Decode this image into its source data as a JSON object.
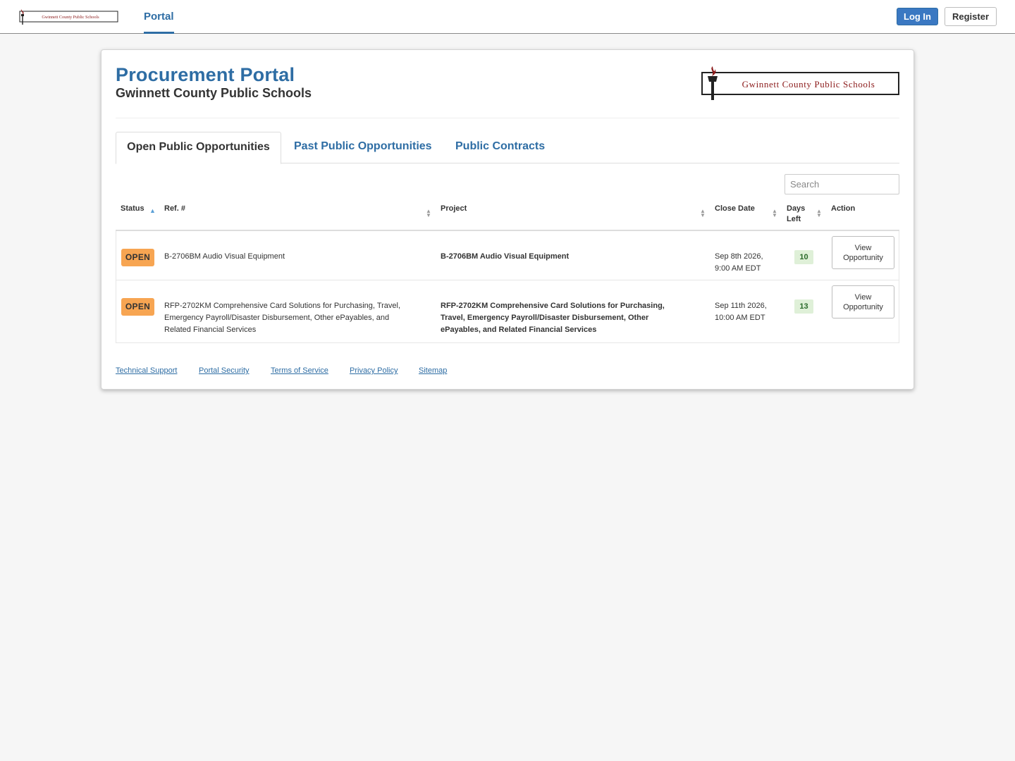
{
  "nav": {
    "logo_text": "Gwinnett County Public Schools",
    "portal_label": "Portal",
    "login_label": "Log In",
    "register_label": "Register"
  },
  "header": {
    "title": "Procurement Portal",
    "subtitle": "Gwinnett County Public Schools",
    "logo_text": "Gwinnett County Public Schools"
  },
  "tabs": [
    {
      "label": "Open Public Opportunities",
      "active": true
    },
    {
      "label": "Past Public Opportunities",
      "active": false
    },
    {
      "label": "Public Contracts",
      "active": false
    }
  ],
  "search": {
    "placeholder": "Search"
  },
  "table": {
    "columns": [
      "Status",
      "Ref. #",
      "Project",
      "Close Date",
      "Days Left",
      "Action"
    ],
    "days_left_lines": [
      "Days",
      "Left"
    ],
    "rows": [
      {
        "status": "OPEN",
        "ref": "B-2706BM Audio Visual Equipment",
        "project": "B-2706BM Audio Visual Equipment",
        "close_date_line1": "Sep 8th 2026,",
        "close_date_line2": "9:00 AM EDT",
        "days_left": "10",
        "action_line1": "View",
        "action_line2": "Opportunity"
      },
      {
        "status": "OPEN",
        "ref_lines": [
          "RFP-2702KM Comprehensive Card Solutions for Purchasing, Travel,",
          "Emergency Payroll/Disaster Disbursement, Other ePayables, and",
          "Related Financial Services"
        ],
        "project_lines": [
          "RFP-2702KM Comprehensive Card Solutions for Purchasing,",
          "Travel, Emergency Payroll/Disaster Disbursement, Other",
          "ePayables, and Related Financial Services"
        ],
        "close_date_line1": "Sep 11th 2026,",
        "close_date_line2": "10:00 AM EDT",
        "days_left": "13",
        "action_line1": "View",
        "action_line2": "Opportunity"
      }
    ]
  },
  "footer": {
    "links": [
      "Technical Support",
      "Portal Security",
      "Terms of Service",
      "Privacy Policy",
      "Sitemap"
    ]
  },
  "colors": {
    "link_blue": "#2e6da4",
    "login_button": "#3a78c2",
    "open_badge": "#f7a552",
    "days_badge": "#dff0d8",
    "logo_red": "#8b1a1a"
  }
}
